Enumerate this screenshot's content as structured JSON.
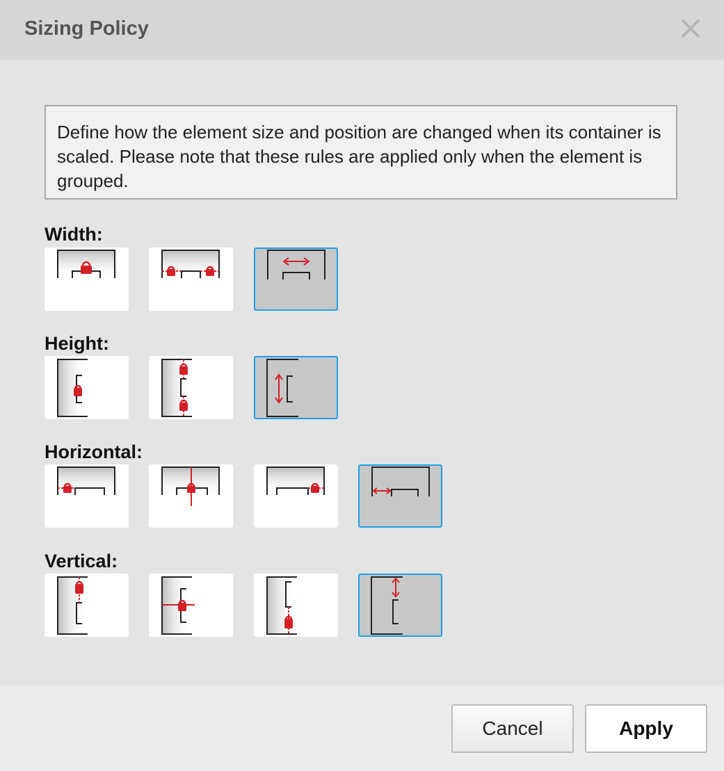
{
  "dialog": {
    "title": "Sizing Policy",
    "description": "Define how the element size and position are changed when its container is scaled. Please note that these rules are applied only when the element is grouped."
  },
  "sections": {
    "width": {
      "label": "Width:",
      "options": [
        "width-fixed-icon",
        "width-anchored-both-icon",
        "width-stretch-icon"
      ],
      "selected_index": 2
    },
    "height": {
      "label": "Height:",
      "options": [
        "height-fixed-icon",
        "height-anchored-both-icon",
        "height-stretch-icon"
      ],
      "selected_index": 2
    },
    "horizontal": {
      "label": "Horizontal:",
      "options": [
        "align-left-icon",
        "align-center-icon",
        "align-right-icon",
        "horizontal-scale-icon"
      ],
      "selected_index": 3
    },
    "vertical": {
      "label": "Vertical:",
      "options": [
        "align-top-icon",
        "align-middle-icon",
        "align-bottom-icon",
        "vertical-scale-icon"
      ],
      "selected_index": 3
    }
  },
  "buttons": {
    "cancel": "Cancel",
    "apply": "Apply"
  },
  "colors": {
    "accent": "#1da1e6",
    "lock": "#d32027",
    "selected_bg": "#c7c7c7"
  }
}
